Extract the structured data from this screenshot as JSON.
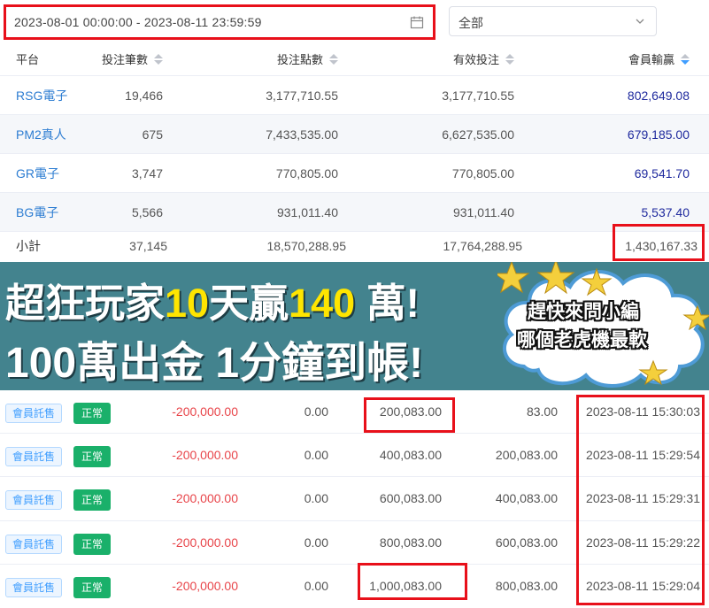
{
  "filter": {
    "date_range": "2023-08-01 00:00:00 - 2023-08-11 23:59:59",
    "platform_select": "全部",
    "calendar_icon": "calendar-icon",
    "dropdown_icon": "chevron-down-icon"
  },
  "summary": {
    "headers": {
      "platform": "平台",
      "bet_count": "投注筆數",
      "bet_points": "投注點數",
      "valid_bet": "有效投注",
      "member_win_loss": "會員輸贏"
    },
    "rows": [
      {
        "platform": "RSG電子",
        "bet_count": "19,466",
        "bet_points": "3,177,710.55",
        "valid_bet": "3,177,710.55",
        "member_win_loss": "802,649.08"
      },
      {
        "platform": "PM2真人",
        "bet_count": "675",
        "bet_points": "7,433,535.00",
        "valid_bet": "6,627,535.00",
        "member_win_loss": "679,185.00"
      },
      {
        "platform": "GR電子",
        "bet_count": "3,747",
        "bet_points": "770,805.00",
        "valid_bet": "770,805.00",
        "member_win_loss": "69,541.70"
      },
      {
        "platform": "BG電子",
        "bet_count": "5,566",
        "bet_points": "931,011.40",
        "valid_bet": "931,011.40",
        "member_win_loss": "5,537.40"
      }
    ],
    "subtotal": {
      "label": "小計",
      "bet_count": "37,145",
      "bet_points": "18,570,288.95",
      "valid_bet": "17,764,288.95",
      "member_win_loss": "1,430,167.33"
    }
  },
  "banner": {
    "line1_a": "超狂玩家",
    "line1_b": "10",
    "line1_c": "天贏",
    "line1_d": "140",
    "line1_e": " 萬!",
    "line2": "100萬出金 1分鐘到帳!",
    "cloud_line1": "趕快來問小編",
    "cloud_line2": "哪個老虎機最軟"
  },
  "transactions": [
    {
      "type": "會員託售",
      "status": "正常",
      "amount": "-200,000.00",
      "zero": "0.00",
      "after": "200,083.00",
      "before": "83.00",
      "time": "2023-08-11 15:30:03"
    },
    {
      "type": "會員託售",
      "status": "正常",
      "amount": "-200,000.00",
      "zero": "0.00",
      "after": "400,083.00",
      "before": "200,083.00",
      "time": "2023-08-11 15:29:54"
    },
    {
      "type": "會員託售",
      "status": "正常",
      "amount": "-200,000.00",
      "zero": "0.00",
      "after": "600,083.00",
      "before": "400,083.00",
      "time": "2023-08-11 15:29:31"
    },
    {
      "type": "會員託售",
      "status": "正常",
      "amount": "-200,000.00",
      "zero": "0.00",
      "after": "800,083.00",
      "before": "600,083.00",
      "time": "2023-08-11 15:29:22"
    },
    {
      "type": "會員託售",
      "status": "正常",
      "amount": "-200,000.00",
      "zero": "0.00",
      "after": "1,000,083.00",
      "before": "800,083.00",
      "time": "2023-08-11 15:29:04"
    }
  ],
  "colors": {
    "highlight_box": "#e8101a",
    "banner_bg": "#43838e",
    "banner_accent": "#ffe500",
    "link": "#2d7dd2",
    "negative": "#e8454a",
    "status_ok": "#1ab06a"
  }
}
